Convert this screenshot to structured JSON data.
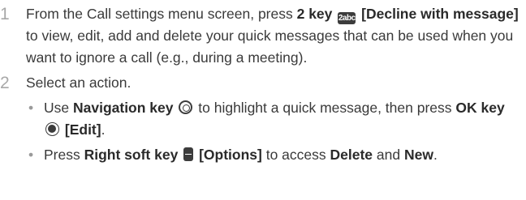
{
  "steps": [
    {
      "number": "1",
      "t1": "From the Call settings menu screen, press ",
      "t2": "2 key",
      "icon_label": "2abc",
      "t3": "[Decline with message]",
      "t4": " to view, edit, add and delete your quick messages that can be used when you want to ignore a call (e.g., during a meeting)."
    },
    {
      "number": "2",
      "text": "Select an action.",
      "bullets": [
        {
          "dot": "•",
          "t1": "Use ",
          "t2": "Navigation key",
          "t3": " to highlight a quick message, then press ",
          "t4": "OK key",
          "t5": "[Edit]",
          "t6": "."
        },
        {
          "dot": "•",
          "t1": "Press ",
          "t2": "Right soft key",
          "t3": "[Options]",
          "t4": " to access ",
          "t5": "Delete",
          "t6": " and ",
          "t7": "New",
          "t8": "."
        }
      ]
    }
  ],
  "icons": {
    "key_2": "key-2-icon",
    "navigation": "navigation-key-icon",
    "ok": "ok-key-icon",
    "right_soft": "right-soft-key-icon"
  },
  "colors": {
    "text": "#3a3a3a",
    "step_number": "#a8a8a8",
    "icon_fill": "#3c3c3c"
  }
}
